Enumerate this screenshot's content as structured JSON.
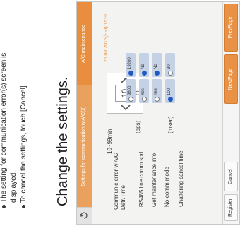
{
  "manual": {
    "bullet1_line1": "The setting for communication error(s) screen is",
    "bullet1_line2": "displayed.",
    "bullet2": "To cancel the settings, touch [Cancel].",
    "heading": "Change the settings."
  },
  "screen": {
    "title": "A/C maintenance",
    "subtitle": "Settings for communication w A/C(2)",
    "datetime": "26.08.2016(FRI) 15:30",
    "menu_icon": "refresh-icon"
  },
  "settings": {
    "comm_error_label_1": "Communic error w A/C",
    "comm_error_label_2": "Detr/Time",
    "comm_error_range": "10~99min",
    "comm_error_value": "10",
    "comm_error_unit": "m",
    "rs485_label": "RS485 line comm spd",
    "rs485_unit": "(bps)",
    "rs485_opt1": "9600",
    "rs485_opt2": "19200",
    "maint_label": "Get maintenance info",
    "maint_yes": "Yes",
    "maint_no": "No",
    "nocomm_label": "No-comm mode",
    "nocomm_yes": "Yes",
    "nocomm_no": "No",
    "chatter_label": "Chattering cancel time",
    "chatter_unit": "(msec)",
    "chatter_opt1": "100",
    "chatter_opt2": "30"
  },
  "nav": {
    "prev": "PrevPage",
    "next": "NextPage",
    "cancel": "Cancel",
    "register": "Register"
  },
  "colors": {
    "header_orange": "#e98e3e",
    "selected_radio": "#1f59c3"
  }
}
